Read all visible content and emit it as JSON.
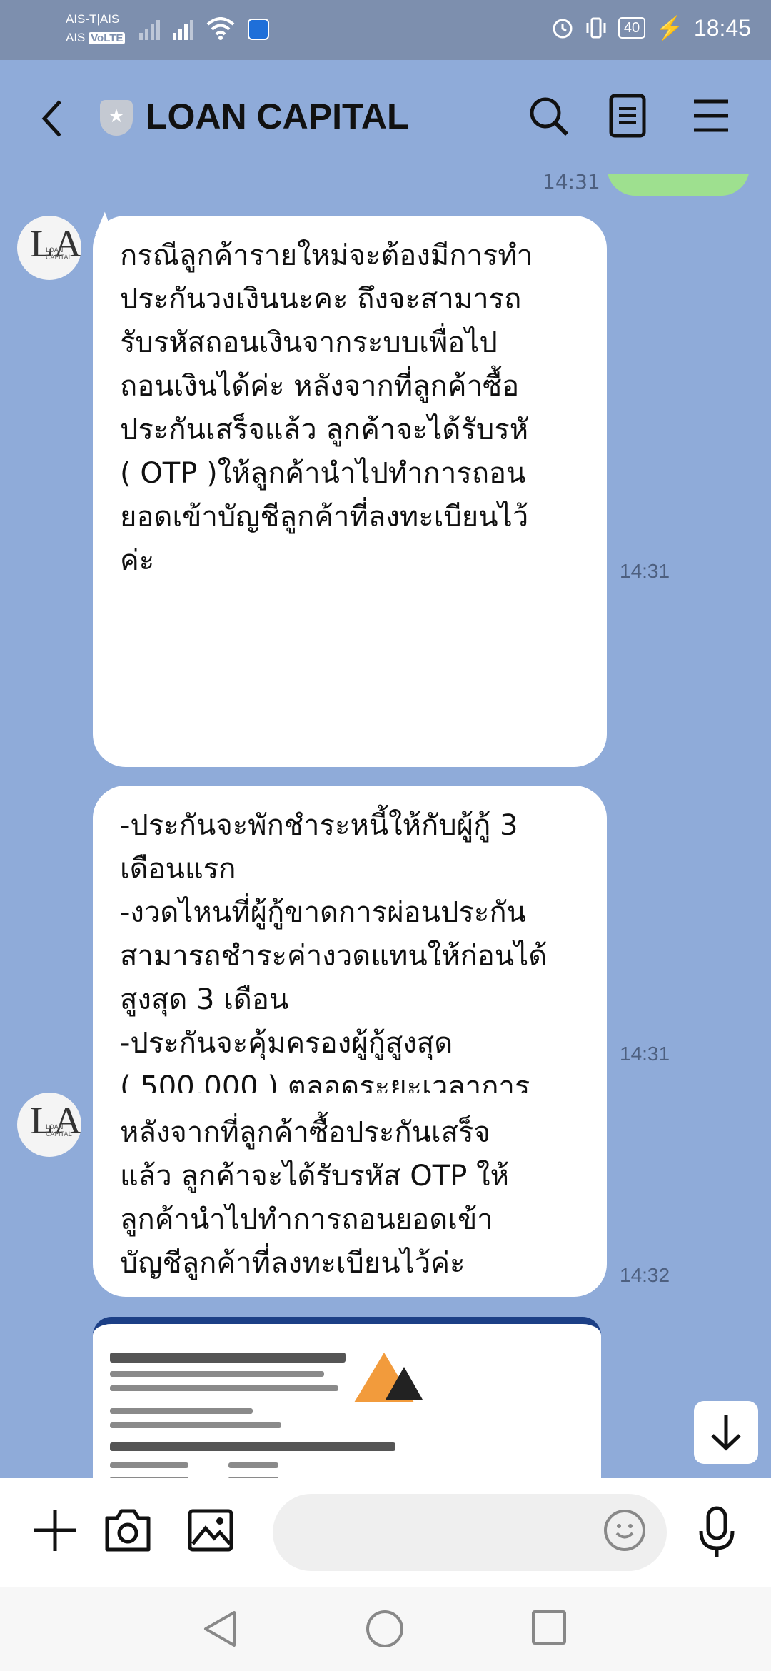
{
  "status_bar": {
    "carrier_1": "AIS-T|AIS",
    "carrier_2": "AIS",
    "volte": "VoLTE",
    "battery": "40",
    "time": "18:45"
  },
  "header": {
    "title": "LOAN CAPITAL"
  },
  "chat": {
    "previous_time": "14:31",
    "avatar_text": "LA",
    "avatar_caption": "LOAN CAPITAL",
    "messages": [
      {
        "text": "กรณีลูกค้ารายใหม่จะต้องมีการทำ\nประกันวงเงินนะคะ ถึงจะสามารถ\nรับรหัสถอนเงินจากระบบเพื่อไป\nถอนเงินได้ค่ะ หลังจากที่ลูกค้าซื้อ\nประกันเสร็จแล้ว ลูกค้าจะได้รับรหั\n( OTP )ให้ลูกค้านำไปทำการถอน\nยอดเข้าบัญชีลูกค้าที่ลงทะเบียนไว้\nค่ะ",
        "time": "14:31"
      },
      {
        "text": "-ประกันจะพักชำระหนี้ให้กับผู้กู้ 3\nเดือนแรก\n-งวดไหนที่ผู้กู้ขาดการผ่อนประกัน\nสามารถชำระค่างวดแทนให้ก่อนได้\nสูงสุด 3 เดือน\n-ประกันจะคุ้มครองผู้กู้สูงสุด\n( 500,000 ) ตลอดระยะเวลาการ\nผ่อน\n-จ่ายเบี้ยประกันครั้งเดียวควบคุม\nตลอดอายุสัญญากู้ค่ะ",
        "time": "14:31"
      },
      {
        "text": "หลังจากที่ลูกค้าซื้อประกันเสร็จ\nแล้ว ลูกค้าจะได้รับรหัส OTP ให้\nลูกค้านำไปทำการถอนยอดเข้า\nบัญชีลูกค้าที่ลงทะเบียนไว้ค่ะ",
        "time": "14:32"
      }
    ]
  },
  "input": {
    "placeholder": ""
  },
  "colors": {
    "chat_background": "#8fabd9",
    "status_bar": "#7d8fae",
    "sent_bubble": "#9ee08f",
    "received_bubble": "#ffffff"
  },
  "icons": [
    "back-icon",
    "verified-shield-icon",
    "search-icon",
    "notes-icon",
    "menu-icon",
    "scroll-down-icon",
    "plus-icon",
    "camera-icon",
    "image-icon",
    "emoji-icon",
    "microphone-icon",
    "nav-back-icon",
    "nav-home-icon",
    "nav-recents-icon"
  ]
}
